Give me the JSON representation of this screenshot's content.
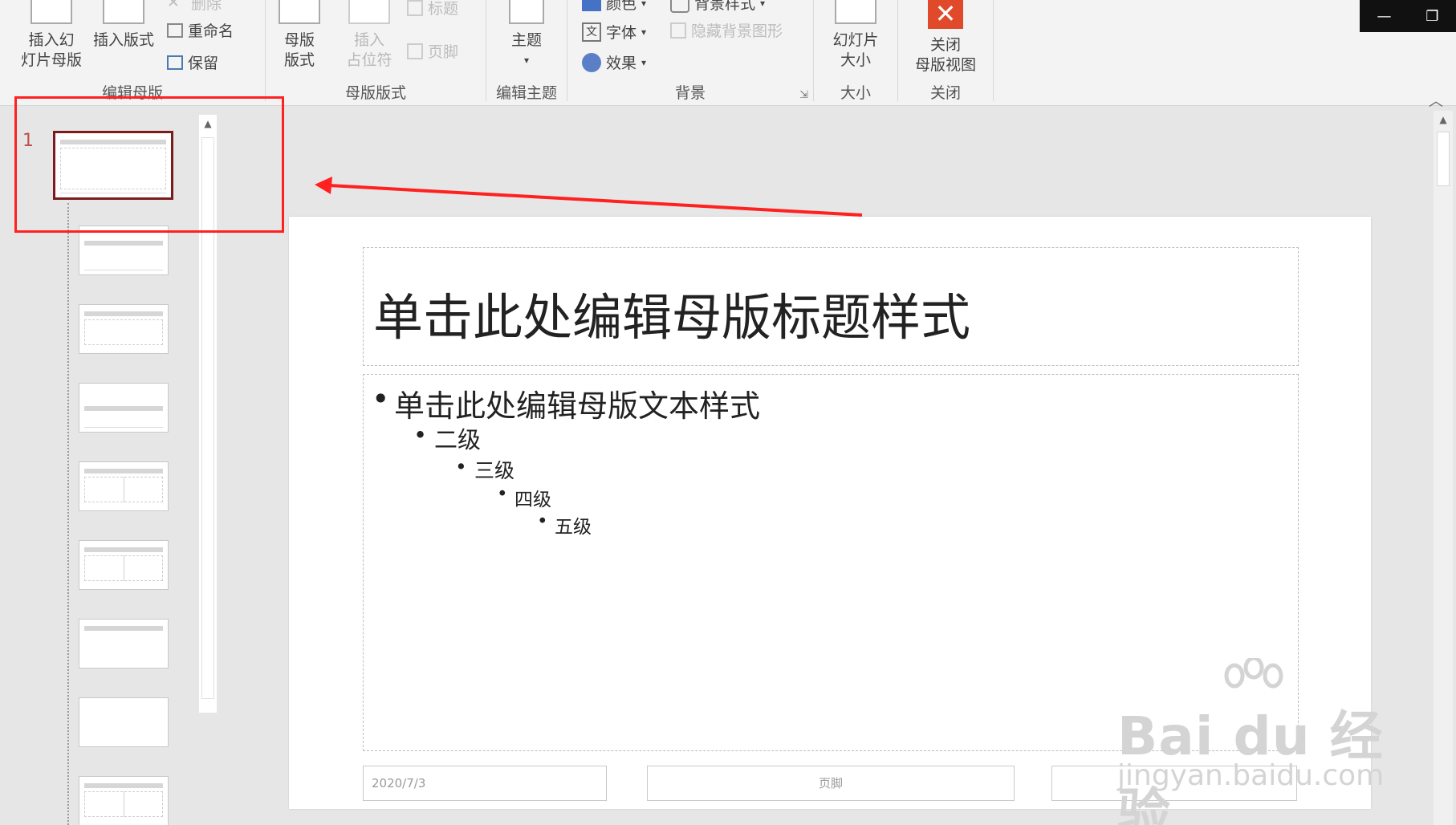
{
  "ribbon": {
    "edit_master": {
      "insert_slide_master": "插入幻\n灯片母版",
      "insert_layout": "插入版式",
      "delete": "删除",
      "rename": "重命名",
      "preserve": "保留",
      "group_label": "编辑母版"
    },
    "master_layout": {
      "master_layout_btn": "母版\n版式",
      "insert_placeholder": "插入\n占位符",
      "title_check": "标题",
      "footer_check": "页脚",
      "group_label": "母版版式"
    },
    "edit_theme": {
      "themes": "主题",
      "group_label": "编辑主题"
    },
    "background": {
      "colors": "颜色",
      "fonts": "字体",
      "effects": "效果",
      "background_styles": "背景样式",
      "hide_bg_graphics": "隐藏背景图形",
      "group_label": "背景"
    },
    "size": {
      "slide_size": "幻灯片\n大小",
      "group_label": "大小"
    },
    "close": {
      "close_master_view": "关闭\n母版视图",
      "group_label": "关闭"
    }
  },
  "thumbnails": {
    "master_number": "1",
    "count": 9
  },
  "slide": {
    "title": "单击此处编辑母版标题样式",
    "levels": [
      "单击此处编辑母版文本样式",
      "二级",
      "三级",
      "四级",
      "五级"
    ],
    "date": "2020/7/3",
    "footer": "页脚",
    "page_number": ""
  },
  "watermark": {
    "brand": "Bai du 经验",
    "url": "jingyan.baidu.com"
  },
  "colors": {
    "highlight": "#ff2020",
    "close_icon": "#e04a2a",
    "master_border": "#7b1c1c"
  }
}
